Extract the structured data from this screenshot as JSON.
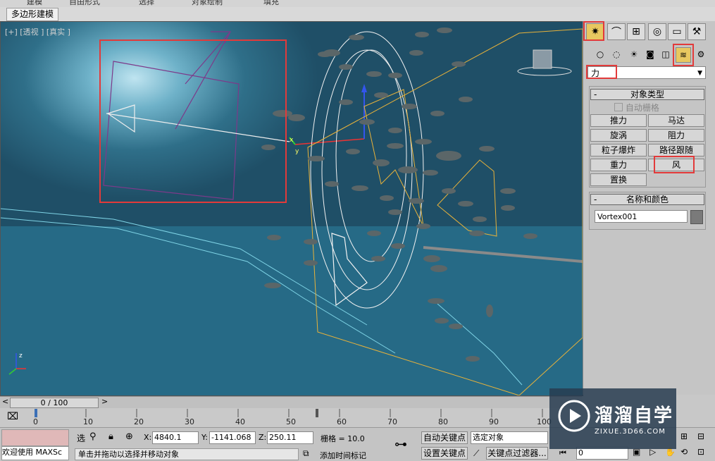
{
  "ribbon": {
    "top_tabs": [
      "建模",
      "自由形式",
      "选择",
      "对象绘制",
      "填充"
    ],
    "sub_tab": "多边形建模"
  },
  "viewport": {
    "label": "[+] [透视 ] [真实 ]",
    "axis_x": "x",
    "axis_y": "y",
    "axis_z": "z"
  },
  "command_panel": {
    "main_tabs": [
      {
        "name": "create",
        "icon": "sun-star-icon"
      },
      {
        "name": "modify",
        "icon": "modify-curve-icon"
      },
      {
        "name": "hierarchy",
        "icon": "hierarchy-icon"
      },
      {
        "name": "motion",
        "icon": "motion-icon"
      },
      {
        "name": "display",
        "icon": "display-icon"
      },
      {
        "name": "utilities",
        "icon": "hammer-icon"
      }
    ],
    "categories": [
      {
        "name": "geometry",
        "icon": "sphere-icon"
      },
      {
        "name": "shapes",
        "icon": "shapes-icon"
      },
      {
        "name": "lights",
        "icon": "light-icon"
      },
      {
        "name": "cameras",
        "icon": "camera-icon"
      },
      {
        "name": "helpers",
        "icon": "helper-icon"
      },
      {
        "name": "space-warps",
        "icon": "space-warp-icon"
      },
      {
        "name": "systems",
        "icon": "gears-icon"
      }
    ],
    "dropdown_value": "力",
    "object_type": {
      "title": "对象类型",
      "autogrid": "自动栅格",
      "buttons": [
        "推力",
        "马达",
        "旋涡",
        "阻力",
        "粒子爆炸",
        "路径跟随",
        "重力",
        "风",
        "置换"
      ]
    },
    "name_color": {
      "title": "名称和颜色",
      "name_value": "Vortex001"
    }
  },
  "timeline": {
    "frame_display": "0 / 100",
    "ticks": [
      "0",
      "10",
      "20",
      "30",
      "40",
      "50",
      "60",
      "70",
      "80",
      "90",
      "100"
    ]
  },
  "status": {
    "welcome": "欢迎使用 MAXSc",
    "prompt": "单击并拖动以选择并移动对象",
    "x_label": "X:",
    "x_value": "4840.1",
    "y_label": "Y:",
    "y_value": "-1141.068",
    "z_label": "Z:",
    "z_value": "250.11",
    "grid": "栅格 = 10.0",
    "add_time_tag": "添加时间标记",
    "auto_key": "自动关键点",
    "set_key": "设置关键点",
    "selected_object": "选定对象",
    "key_filters": "关键点过滤器...",
    "frame_field": "0"
  },
  "watermark": {
    "title": "溜溜自学",
    "url": "ZIXUE.3D66.COM"
  }
}
